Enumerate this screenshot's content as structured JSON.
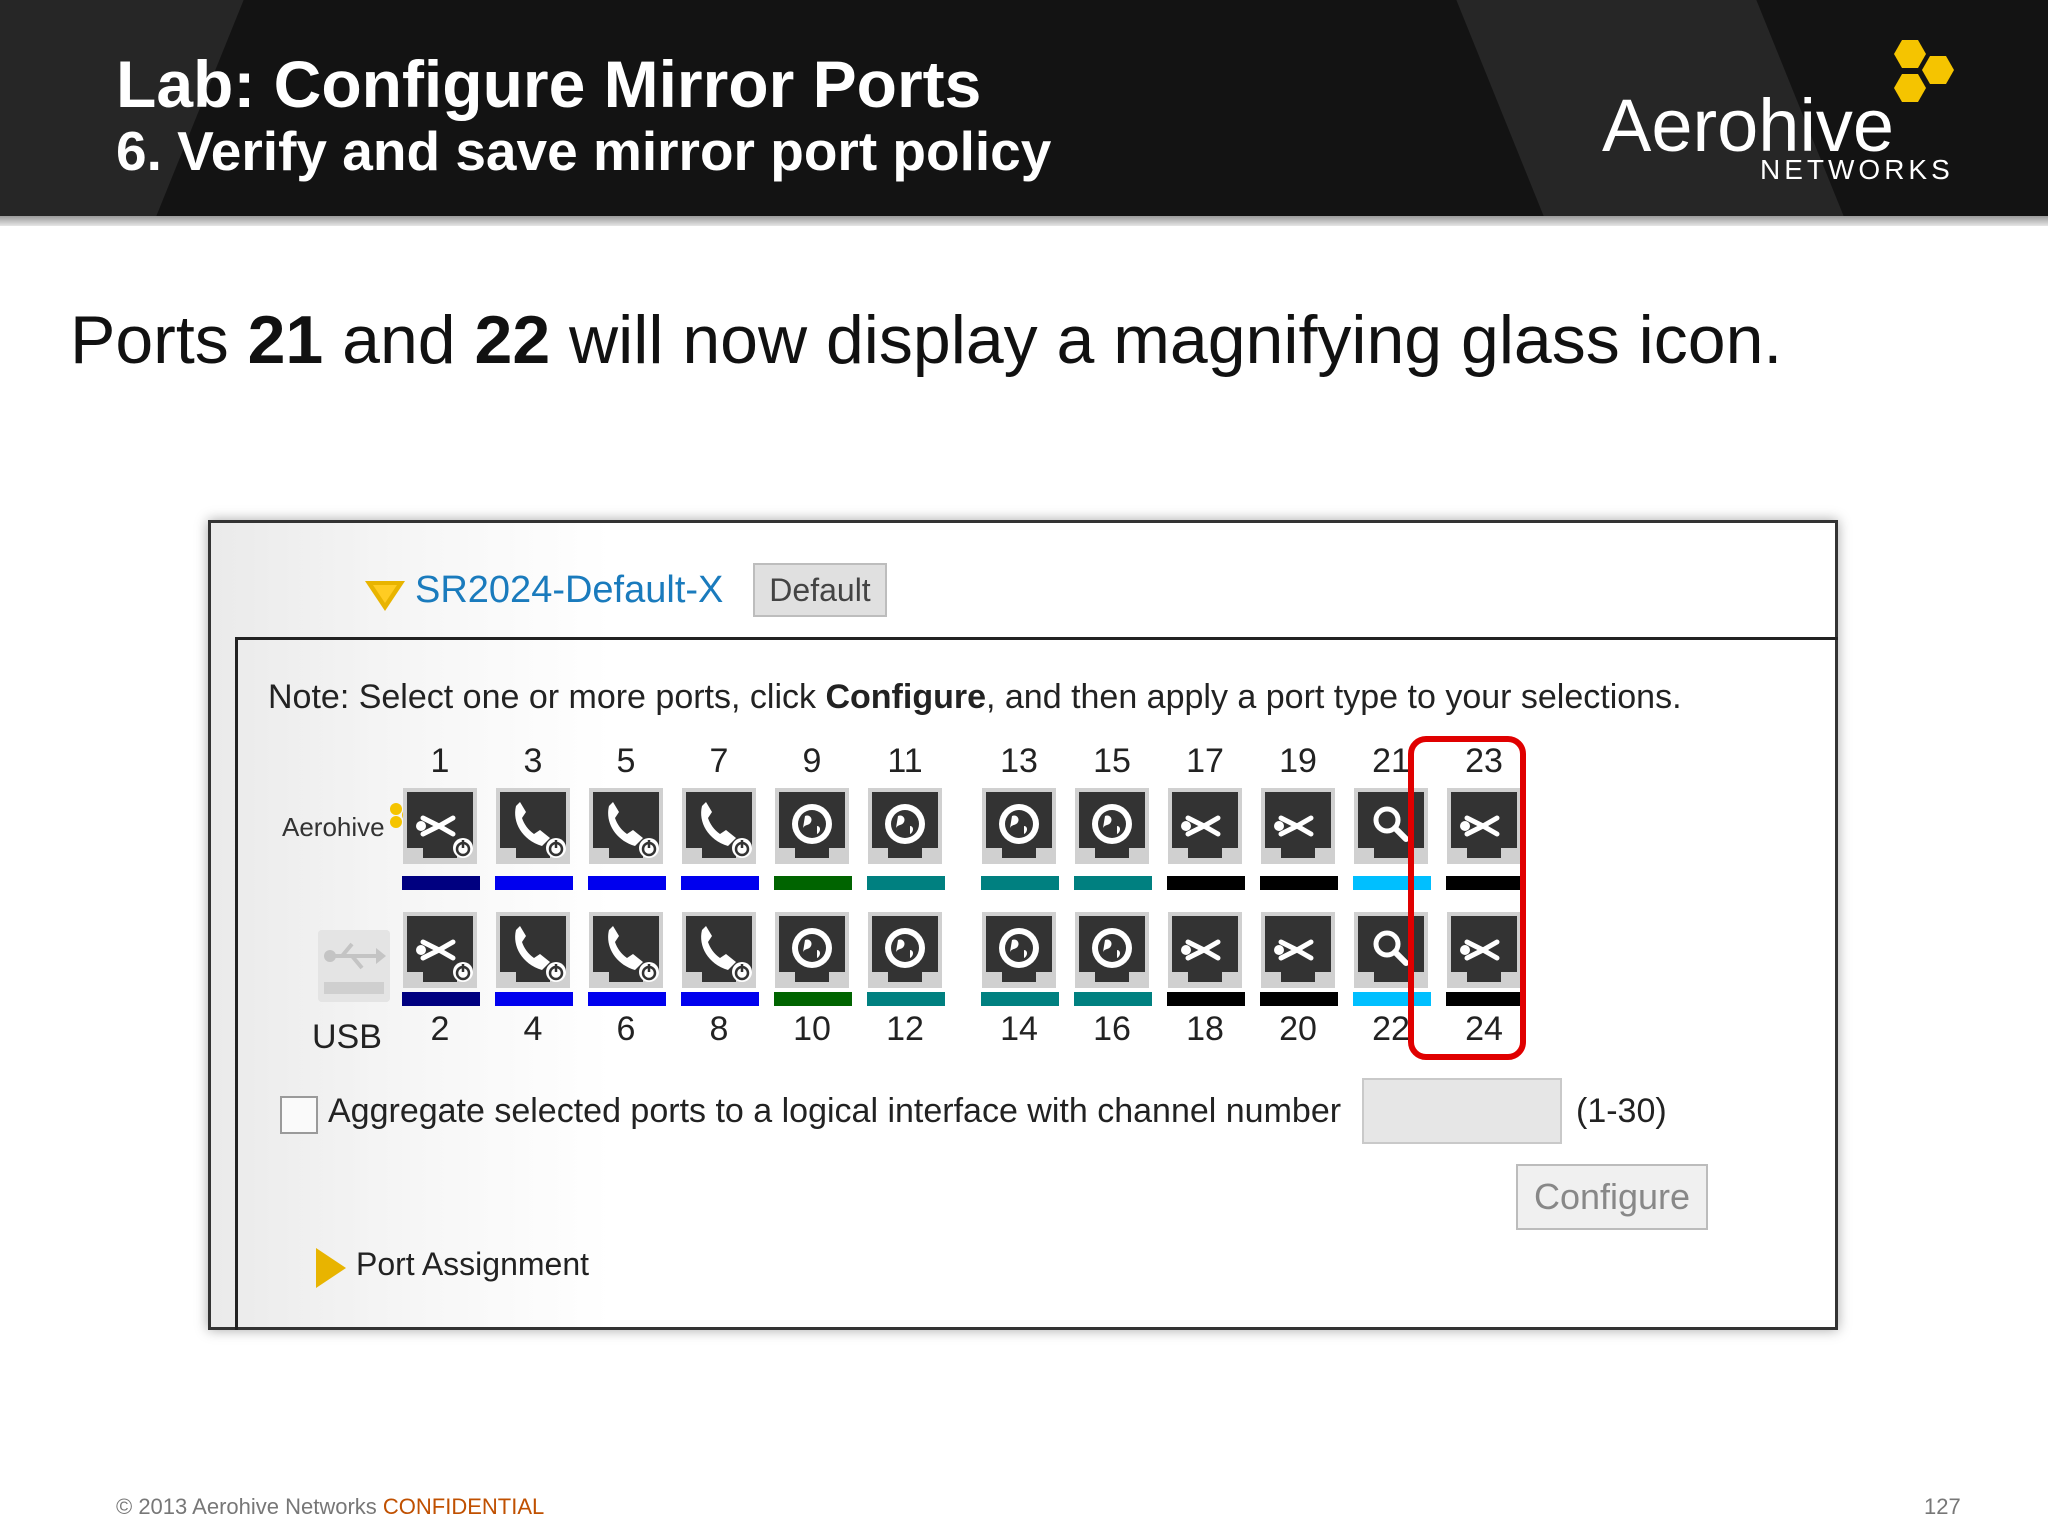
{
  "header": {
    "title": "Lab: Configure Mirror Ports",
    "subtitle": "6. Verify and save mirror port policy",
    "logo_word": "Aerohive",
    "logo_sub": "NETWORKS"
  },
  "statement": {
    "t1": "Ports ",
    "b1": "21",
    "t2": " and ",
    "b2": "22",
    "t3": " will now display a magnifying glass icon."
  },
  "screenshot": {
    "profile_name": "SR2024-Default-X",
    "default_label": "Default",
    "note_pre": "Note: Select one or more ports, click ",
    "note_bold": "Configure",
    "note_post": ", and then apply a port type to your selections.",
    "mini_logo": "Aerohive",
    "usb_label": "USB",
    "top_ports": [
      {
        "num": "1",
        "icon": "access-icon",
        "power": true,
        "bar": "#000080"
      },
      {
        "num": "3",
        "icon": "phone-icon",
        "power": true,
        "bar": "#0000ee"
      },
      {
        "num": "5",
        "icon": "phone-icon",
        "power": true,
        "bar": "#0000ee"
      },
      {
        "num": "7",
        "icon": "phone-icon",
        "power": true,
        "bar": "#0000ee"
      },
      {
        "num": "9",
        "icon": "wan-icon",
        "power": false,
        "bar": "#006400"
      },
      {
        "num": "11",
        "icon": "wan-icon",
        "power": false,
        "bar": "#008080"
      },
      {
        "num": "13",
        "icon": "wan-icon",
        "power": false,
        "bar": "#008080"
      },
      {
        "num": "15",
        "icon": "wan-icon",
        "power": false,
        "bar": "#008080"
      },
      {
        "num": "17",
        "icon": "access-icon",
        "power": false,
        "bar": "#000000"
      },
      {
        "num": "19",
        "icon": "access-icon",
        "power": false,
        "bar": "#000000"
      },
      {
        "num": "21",
        "icon": "magnifier-icon",
        "power": false,
        "bar": "#00bfff"
      },
      {
        "num": "23",
        "icon": "access-icon",
        "power": false,
        "bar": "#000000"
      }
    ],
    "bottom_ports": [
      {
        "num": "2",
        "icon": "access-icon",
        "power": true,
        "bar": "#000080"
      },
      {
        "num": "4",
        "icon": "phone-icon",
        "power": true,
        "bar": "#0000ee"
      },
      {
        "num": "6",
        "icon": "phone-icon",
        "power": true,
        "bar": "#0000ee"
      },
      {
        "num": "8",
        "icon": "phone-icon",
        "power": true,
        "bar": "#0000ee"
      },
      {
        "num": "10",
        "icon": "wan-icon",
        "power": false,
        "bar": "#006400"
      },
      {
        "num": "12",
        "icon": "wan-icon",
        "power": false,
        "bar": "#008080"
      },
      {
        "num": "14",
        "icon": "wan-icon",
        "power": false,
        "bar": "#008080"
      },
      {
        "num": "16",
        "icon": "wan-icon",
        "power": false,
        "bar": "#008080"
      },
      {
        "num": "18",
        "icon": "access-icon",
        "power": false,
        "bar": "#000000"
      },
      {
        "num": "20",
        "icon": "access-icon",
        "power": false,
        "bar": "#000000"
      },
      {
        "num": "22",
        "icon": "magnifier-icon",
        "power": false,
        "bar": "#00bfff"
      },
      {
        "num": "24",
        "icon": "access-icon",
        "power": false,
        "bar": "#000000"
      }
    ],
    "aggregate_label": "Aggregate selected ports to a logical interface with channel number",
    "aggregate_range": "(1-30)",
    "configure_label": "Configure",
    "port_assignment": "Port Assignment"
  },
  "footer": {
    "copyright": "© 2013 Aerohive Networks ",
    "confidential": "CONFIDENTIAL",
    "page": "127"
  },
  "colors": {
    "brand_yellow": "#f5c400",
    "link_blue": "#1a7bbd",
    "highlight_red": "#e00000"
  }
}
